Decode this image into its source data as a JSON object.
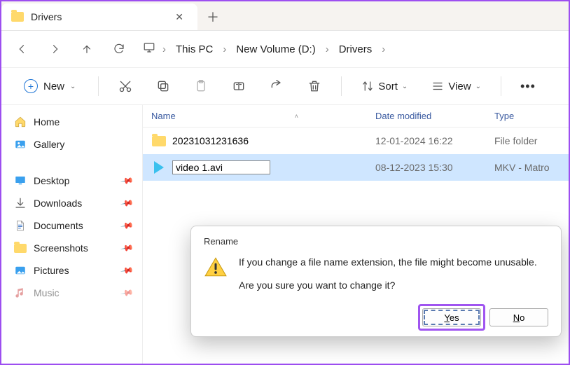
{
  "tab": {
    "title": "Drivers"
  },
  "breadcrumb": {
    "segments": [
      "This PC",
      "New Volume (D:)",
      "Drivers"
    ]
  },
  "toolbar": {
    "new_label": "New",
    "sort_label": "Sort",
    "view_label": "View"
  },
  "sidebar": {
    "primary": [
      {
        "label": "Home",
        "icon": "home-icon"
      },
      {
        "label": "Gallery",
        "icon": "gallery-icon"
      }
    ],
    "pinned": [
      {
        "label": "Desktop",
        "icon": "desktop-icon"
      },
      {
        "label": "Downloads",
        "icon": "downloads-icon"
      },
      {
        "label": "Documents",
        "icon": "documents-icon"
      },
      {
        "label": "Screenshots",
        "icon": "folder-icon"
      },
      {
        "label": "Pictures",
        "icon": "pictures-icon"
      },
      {
        "label": "Music",
        "icon": "music-icon"
      }
    ]
  },
  "columns": {
    "name": "Name",
    "date": "Date modified",
    "type": "Type"
  },
  "rows": [
    {
      "name": "20231031231636",
      "date": "12-01-2024 16:22",
      "type": "File folder",
      "kind": "folder"
    },
    {
      "name": "video 1.avi",
      "date": "08-12-2023 15:30",
      "type": "MKV - Matro",
      "kind": "video",
      "renaming": true,
      "selected": true
    }
  ],
  "dialog": {
    "title": "Rename",
    "line1": "If you change a file name extension, the file might become unusable.",
    "line2": "Are you sure you want to change it?",
    "yes": "Yes",
    "no": "No"
  }
}
